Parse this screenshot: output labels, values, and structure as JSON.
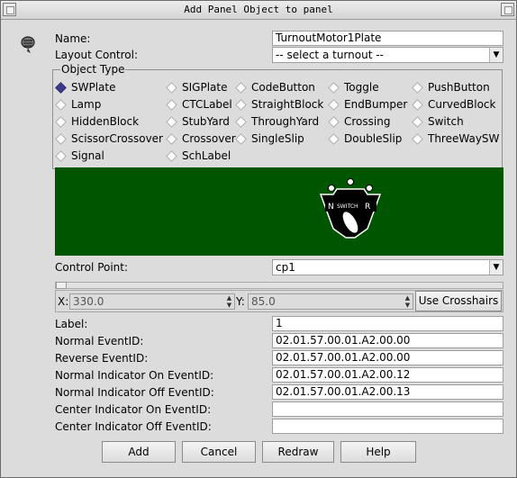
{
  "window": {
    "title": "Add Panel Object to panel"
  },
  "form": {
    "name_label": "Name:",
    "name_value": "TurnoutMotor1Plate",
    "layout_label": "Layout Control:",
    "layout_value": "-- select a turnout --",
    "object_type_label": "Object Type",
    "object_types": [
      {
        "label": "SWPlate",
        "selected": true
      },
      {
        "label": "SIGPlate",
        "selected": false
      },
      {
        "label": "CodeButton",
        "selected": false
      },
      {
        "label": "Toggle",
        "selected": false
      },
      {
        "label": "PushButton",
        "selected": false
      },
      {
        "label": "Lamp",
        "selected": false
      },
      {
        "label": "CTCLabel",
        "selected": false
      },
      {
        "label": "StraightBlock",
        "selected": false
      },
      {
        "label": "EndBumper",
        "selected": false
      },
      {
        "label": "CurvedBlock",
        "selected": false
      },
      {
        "label": "HiddenBlock",
        "selected": false
      },
      {
        "label": "StubYard",
        "selected": false
      },
      {
        "label": "ThroughYard",
        "selected": false
      },
      {
        "label": "Crossing",
        "selected": false
      },
      {
        "label": "Switch",
        "selected": false
      },
      {
        "label": "ScissorCrossover",
        "selected": false
      },
      {
        "label": "Crossover",
        "selected": false
      },
      {
        "label": "SingleSlip",
        "selected": false
      },
      {
        "label": "DoubleSlip",
        "selected": false
      },
      {
        "label": "ThreeWaySW",
        "selected": false
      },
      {
        "label": "Signal",
        "selected": false
      },
      {
        "label": "SchLabel",
        "selected": false
      }
    ],
    "preview": {
      "plate_text": "SWITCH",
      "plate_left": "N",
      "plate_right": "R"
    },
    "control_point_label": "Control Point:",
    "control_point_value": "cp1",
    "x_label": "X:",
    "x_value": "330.0",
    "y_label": "Y:",
    "y_value": "85.0",
    "crosshairs_label": "Use Crosshairs",
    "label_label": "Label:",
    "label_value": "1",
    "normal_event_label": "Normal EventID:",
    "normal_event_value": "02.01.57.00.01.A2.00.00",
    "reverse_event_label": "Reverse EventID:",
    "reverse_event_value": "02.01.57.00.01.A2.00.00",
    "normal_ind_on_label": "Normal Indicator On EventID:",
    "normal_ind_on_value": "02.01.57.00.01.A2.00.12",
    "normal_ind_off_label": "Normal Indicator Off EventID:",
    "normal_ind_off_value": "02.01.57.00.01.A2.00.13",
    "center_ind_on_label": "Center Indicator On EventID:",
    "center_ind_on_value": "",
    "center_ind_off_label": "Center Indicator Off EventID:",
    "center_ind_off_value": ""
  },
  "buttons": {
    "add": "Add",
    "cancel": "Cancel",
    "redraw": "Redraw",
    "help": "Help"
  },
  "colors": {
    "preview_bg": "#005500",
    "radio_selected": "#3a3a8a"
  }
}
